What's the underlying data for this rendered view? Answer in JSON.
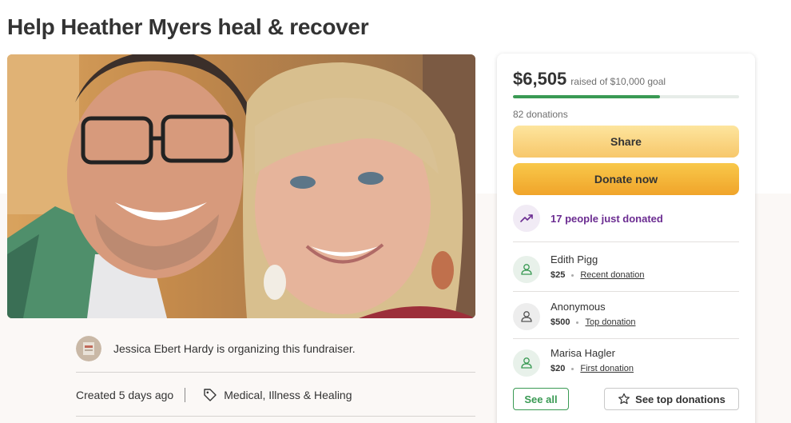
{
  "title": "Help Heather Myers heal & recover",
  "organizer": {
    "text": "Jessica Ebert Hardy is organizing this fundraiser."
  },
  "meta": {
    "created": "Created 5 days ago",
    "category": "Medical, Illness & Healing"
  },
  "card": {
    "raised_amount": "$6,505",
    "raised_goal": "raised of $10,000 goal",
    "progress_fraction": 0.6505,
    "donations_count": "82 donations",
    "share_label": "Share",
    "donate_label": "Donate now",
    "trend_text": "17 people just donated",
    "donors": [
      {
        "name": "Edith Pigg",
        "amount": "$25",
        "label": "Recent donation"
      },
      {
        "name": "Anonymous",
        "amount": "$500",
        "label": "Top donation"
      },
      {
        "name": "Marisa Hagler",
        "amount": "$20",
        "label": "First donation"
      }
    ],
    "see_all_label": "See all",
    "see_top_label": "See top donations"
  },
  "colors": {
    "accent_green": "#3a9a54",
    "trend_purple": "#6b2c91",
    "share_yellow": "#f7c76a",
    "donate_orange": "#f0a42a"
  }
}
